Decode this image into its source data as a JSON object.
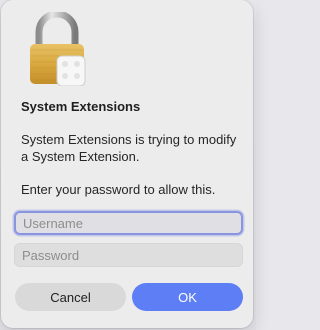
{
  "dialog": {
    "icon": "padlock-icon",
    "title": "System Extensions",
    "message": "System Extensions is trying to modify a System Extension.",
    "prompt": "Enter your password to allow this.",
    "username_placeholder": "Username",
    "password_placeholder": "Password",
    "cancel_label": "Cancel",
    "ok_label": "OK"
  },
  "colors": {
    "accent": "#5d7ef4",
    "focus_ring": "#8a95e0",
    "dialog_background": "#ececec"
  }
}
